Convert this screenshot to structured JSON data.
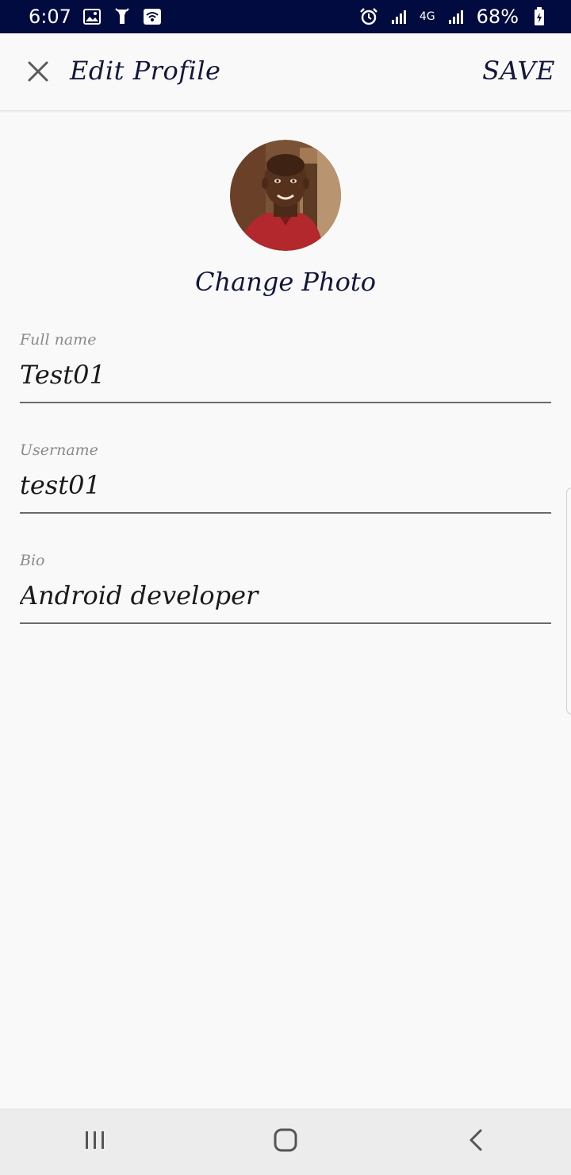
{
  "status_bar": {
    "time": "6:07",
    "battery": "68%",
    "network": "4G",
    "icons_left": [
      "gallery-icon",
      "flashlight-icon",
      "wifi-icon"
    ],
    "icons_right": [
      "alarm-icon",
      "signal-icon",
      "signal-icon",
      "battery-icon"
    ]
  },
  "app_bar": {
    "title": "Edit Profile",
    "save_label": "SAVE",
    "close_icon": "close-icon"
  },
  "profile": {
    "change_photo_label": "Change Photo"
  },
  "form": {
    "full_name": {
      "label": "Full name",
      "value": "Test01"
    },
    "username": {
      "label": "Username",
      "value": "test01"
    },
    "bio": {
      "label": "Bio",
      "value": "Android developer"
    }
  },
  "nav_bar": {
    "buttons": [
      "recents-icon",
      "home-icon",
      "back-icon"
    ]
  },
  "colors": {
    "status_bar": "#020b3f",
    "text_primary": "#13173a",
    "label_gray": "#8a8a8a",
    "background": "#f9f9f9"
  }
}
